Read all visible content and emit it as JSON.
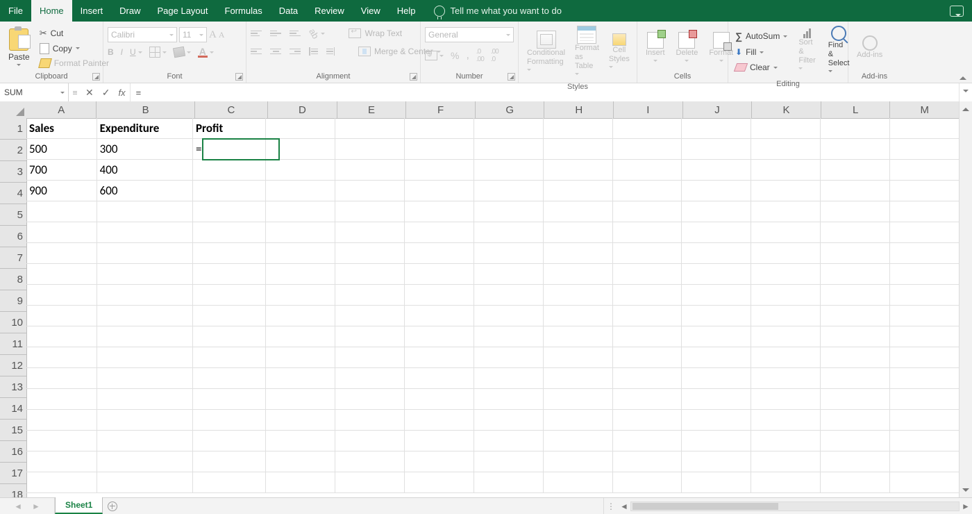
{
  "tabs": {
    "file": "File",
    "home": "Home",
    "insert": "Insert",
    "draw": "Draw",
    "pageLayout": "Page Layout",
    "formulas": "Formulas",
    "data": "Data",
    "review": "Review",
    "view": "View",
    "help": "Help",
    "tellMe": "Tell me what you want to do"
  },
  "ribbon": {
    "clipboard": {
      "label": "Clipboard",
      "paste": "Paste",
      "cut": "Cut",
      "copy": "Copy",
      "formatPainter": "Format Painter"
    },
    "font": {
      "label": "Font",
      "name": "Calibri",
      "size": "11",
      "bold": "B",
      "italic": "I",
      "underline": "U",
      "fontColorLetter": "A",
      "growLetter": "A",
      "shrinkLetter": "A"
    },
    "alignment": {
      "label": "Alignment",
      "wrap": "Wrap Text",
      "merge": "Merge & Center"
    },
    "number": {
      "label": "Number",
      "format": "General",
      "pct": "%",
      "comma": ",",
      "decInc": ".00→.0",
      "decDec": ".0→.00"
    },
    "styles": {
      "label": "Styles",
      "cond": "Conditional Formatting",
      "cond1": "Conditional",
      "cond2": "Formatting",
      "fat": "Format as Table",
      "fat1": "Format as",
      "fat2": "Table",
      "cell": "Cell Styles",
      "cell1": "Cell",
      "cell2": "Styles"
    },
    "cells": {
      "label": "Cells",
      "insert": "Insert",
      "delete": "Delete",
      "format": "Format"
    },
    "editing": {
      "label": "Editing",
      "autosum": "AutoSum",
      "fill": "Fill",
      "clear": "Clear",
      "sort": "Sort & Filter",
      "sort1": "Sort &",
      "sort2": "Filter",
      "find": "Find & Select",
      "find1": "Find &",
      "find2": "Select"
    },
    "addins": {
      "label": "Add-ins",
      "addins": "Add-ins"
    }
  },
  "formulaBar": {
    "nameBox": "SUM",
    "fx": "fx",
    "formula": "="
  },
  "grid": {
    "columns": [
      "A",
      "B",
      "C",
      "D",
      "E",
      "F",
      "G",
      "H",
      "I",
      "J",
      "K",
      "L",
      "M"
    ],
    "rowCount": 18,
    "headers": {
      "A1": "Sales",
      "B1": "Expenditure",
      "C1": "Profit"
    },
    "data": {
      "A2": "500",
      "B2": "300",
      "C2": "=",
      "A3": "700",
      "B3": "400",
      "A4": "900",
      "B4": "600"
    },
    "activeCell": "C2"
  },
  "sheet": {
    "name": "Sheet1"
  }
}
